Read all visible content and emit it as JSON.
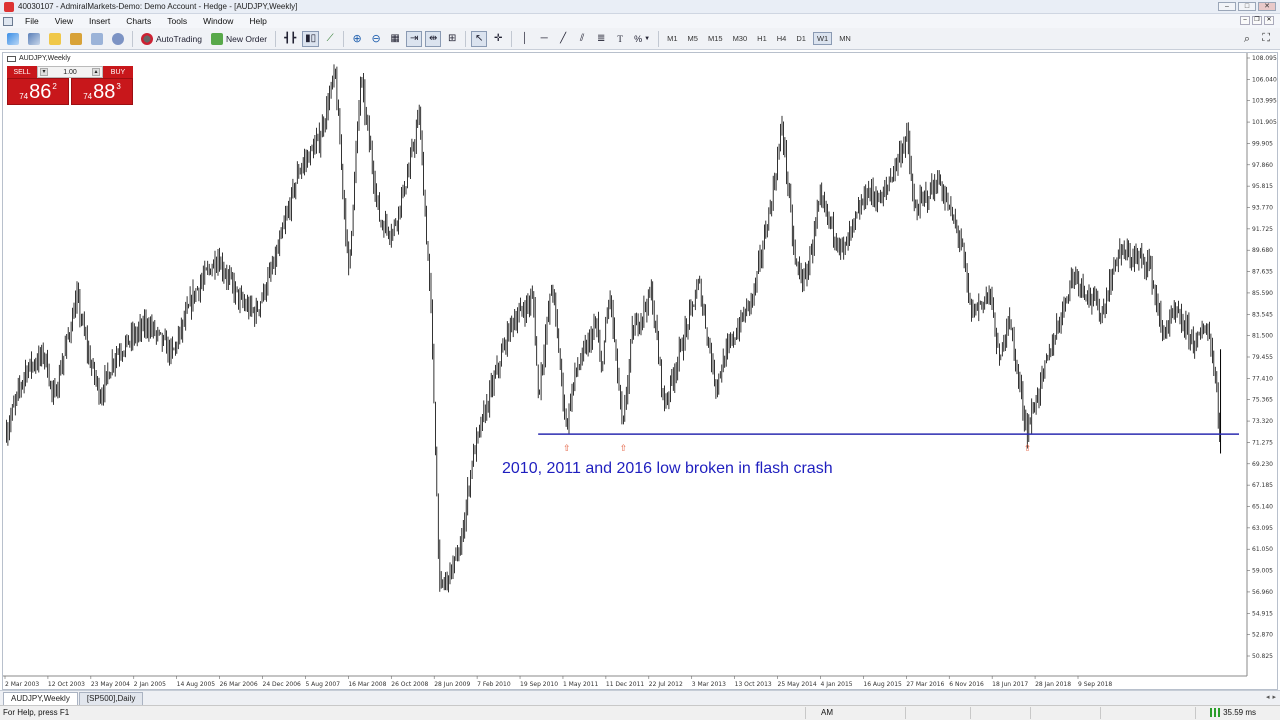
{
  "window": {
    "title": "40030107 - AdmiralMarkets-Demo: Demo Account - Hedge - [AUDJPY,Weekly]",
    "controls": [
      "minimize",
      "maximize",
      "close"
    ]
  },
  "menu": {
    "items": [
      "File",
      "View",
      "Insert",
      "Charts",
      "Tools",
      "Window",
      "Help"
    ]
  },
  "toolbar": {
    "autotrading_label": "AutoTrading",
    "new_order_label": "New Order",
    "timeframes": [
      "M1",
      "M5",
      "M15",
      "M30",
      "H1",
      "H4",
      "D1",
      "W1",
      "MN"
    ],
    "active_timeframe": "W1",
    "percent_icon_label": "%"
  },
  "chart": {
    "symbol_label": "AUDJPY,Weekly",
    "one_click": {
      "sell_label": "SELL",
      "buy_label": "BUY",
      "lot": "1.00",
      "sell_prefix": "74",
      "sell_big": "86",
      "sell_sup": "2",
      "buy_prefix": "74",
      "buy_big": "88",
      "buy_sup": "3"
    },
    "annotation": "2010, 2011 and 2016 low broken in flash crash",
    "support_level": 72.2,
    "colors": {
      "support_line": "#2b2bb0",
      "annotation": "#1f1fbf",
      "bars": "#000000",
      "arrows": "#e25a3a"
    }
  },
  "chart_data": {
    "type": "ohlc",
    "title": "AUDJPY,Weekly",
    "price_ticks": [
      "108.095",
      "106.040",
      "103.995",
      "101.905",
      "99.905",
      "97.860",
      "95.815",
      "93.770",
      "91.725",
      "89.680",
      "87.635",
      "85.590",
      "83.545",
      "81.500",
      "79.455",
      "77.410",
      "75.365",
      "73.320",
      "71.275",
      "69.230",
      "67.185",
      "65.140",
      "63.095",
      "61.050",
      "59.005",
      "56.960",
      "54.915",
      "52.870",
      "50.825"
    ],
    "date_ticks": [
      "2 Mar 2003",
      "12 Oct 2003",
      "23 May 2004",
      "2 Jan 2005",
      "14 Aug 2005",
      "26 Mar 2006",
      "24 Dec 2006",
      "5 Aug 2007",
      "16 Mar 2008",
      "26 Oct 2008",
      "28 Jun 2009",
      "7 Feb 2010",
      "19 Sep 2010",
      "1 May 2011",
      "11 Dec 2011",
      "22 Jul 2012",
      "3 Mar 2013",
      "13 Oct 2013",
      "25 May 2014",
      "4 Jan 2015",
      "16 Aug 2015",
      "27 Mar 2016",
      "6 Nov 2016",
      "18 Jun 2017",
      "28 Jan 2018",
      "9 Sep 2018"
    ],
    "ylim": [
      49.8,
      109.1
    ],
    "path": [
      [
        "2003-03-02",
        72.5
      ],
      [
        "2003-06-01",
        78.5
      ],
      [
        "2003-09-01",
        80.0
      ],
      [
        "2003-10-12",
        75.5
      ],
      [
        "2004-02-01",
        85.5
      ],
      [
        "2004-04-01",
        79.5
      ],
      [
        "2004-05-23",
        76.0
      ],
      [
        "2004-08-01",
        80.0
      ],
      [
        "2005-01-02",
        83.0
      ],
      [
        "2005-05-01",
        80.0
      ],
      [
        "2005-08-14",
        86.0
      ],
      [
        "2005-12-01",
        89.5
      ],
      [
        "2006-03-26",
        85.0
      ],
      [
        "2006-06-01",
        84.0
      ],
      [
        "2006-09-01",
        89.0
      ],
      [
        "2006-12-24",
        98.0
      ],
      [
        "2007-04-01",
        101.0
      ],
      [
        "2007-06-15",
        107.5
      ],
      [
        "2007-08-19",
        88.0
      ],
      [
        "2007-10-15",
        107.0
      ],
      [
        "2008-01-15",
        93.0
      ],
      [
        "2008-03-16",
        92.0
      ],
      [
        "2008-06-01",
        98.0
      ],
      [
        "2008-07-20",
        103.5
      ],
      [
        "2008-09-15",
        84.0
      ],
      [
        "2008-10-26",
        57.0
      ],
      [
        "2008-12-01",
        58.0
      ],
      [
        "2009-02-01",
        61.0
      ],
      [
        "2009-04-01",
        70.0
      ],
      [
        "2009-06-28",
        76.5
      ],
      [
        "2009-10-01",
        83.0
      ],
      [
        "2010-01-15",
        85.5
      ],
      [
        "2010-02-07",
        76.0
      ],
      [
        "2010-04-15",
        87.0
      ],
      [
        "2010-06-20",
        73.0
      ],
      [
        "2010-08-01",
        78.0
      ],
      [
        "2010-11-15",
        83.0
      ],
      [
        "2010-12-01",
        78.0
      ],
      [
        "2011-01-15",
        86.0
      ],
      [
        "2011-03-17",
        72.5
      ],
      [
        "2011-05-01",
        82.0
      ],
      [
        "2011-08-01",
        86.0
      ],
      [
        "2011-10-01",
        75.0
      ],
      [
        "2011-12-11",
        80.0
      ],
      [
        "2012-03-15",
        87.0
      ],
      [
        "2012-06-01",
        77.0
      ],
      [
        "2012-07-22",
        80.0
      ],
      [
        "2012-12-01",
        86.0
      ],
      [
        "2013-03-03",
        96.0
      ],
      [
        "2013-04-15",
        102.5
      ],
      [
        "2013-06-15",
        89.0
      ],
      [
        "2013-08-01",
        87.0
      ],
      [
        "2013-10-13",
        95.0
      ],
      [
        "2014-02-01",
        90.0
      ],
      [
        "2014-05-25",
        96.0
      ],
      [
        "2014-08-01",
        95.0
      ],
      [
        "2014-12-01",
        101.5
      ],
      [
        "2015-01-04",
        94.0
      ],
      [
        "2015-05-01",
        97.0
      ],
      [
        "2015-08-16",
        91.0
      ],
      [
        "2015-10-01",
        84.0
      ],
      [
        "2016-01-01",
        86.0
      ],
      [
        "2016-02-15",
        79.0
      ],
      [
        "2016-03-27",
        84.0
      ],
      [
        "2016-06-24",
        72.5
      ],
      [
        "2016-11-06",
        82.0
      ],
      [
        "2017-02-01",
        88.0
      ],
      [
        "2017-06-18",
        84.0
      ],
      [
        "2017-09-01",
        90.0
      ],
      [
        "2018-01-28",
        89.0
      ],
      [
        "2018-04-01",
        82.0
      ],
      [
        "2018-06-01",
        84.0
      ],
      [
        "2018-09-09",
        81.0
      ],
      [
        "2018-11-01",
        83.0
      ],
      [
        "2018-12-15",
        77.0
      ],
      [
        "2019-01-03",
        71.0
      ]
    ],
    "support_line": {
      "value": 72.2,
      "from": "2010-02-07",
      "to": "2019-04-01"
    },
    "swing_low_markers": [
      "2010-06-20",
      "2011-03-17",
      "2016-06-24"
    ],
    "annotation": "2010, 2011 and 2016 low broken in flash crash"
  },
  "tabs": [
    {
      "label": "AUDJPY,Weekly",
      "active": true
    },
    {
      "label": "[SP500],Daily",
      "active": false
    }
  ],
  "statusbar": {
    "help": "For Help, press F1",
    "mode": "AM",
    "connection": "35.59 ms"
  }
}
